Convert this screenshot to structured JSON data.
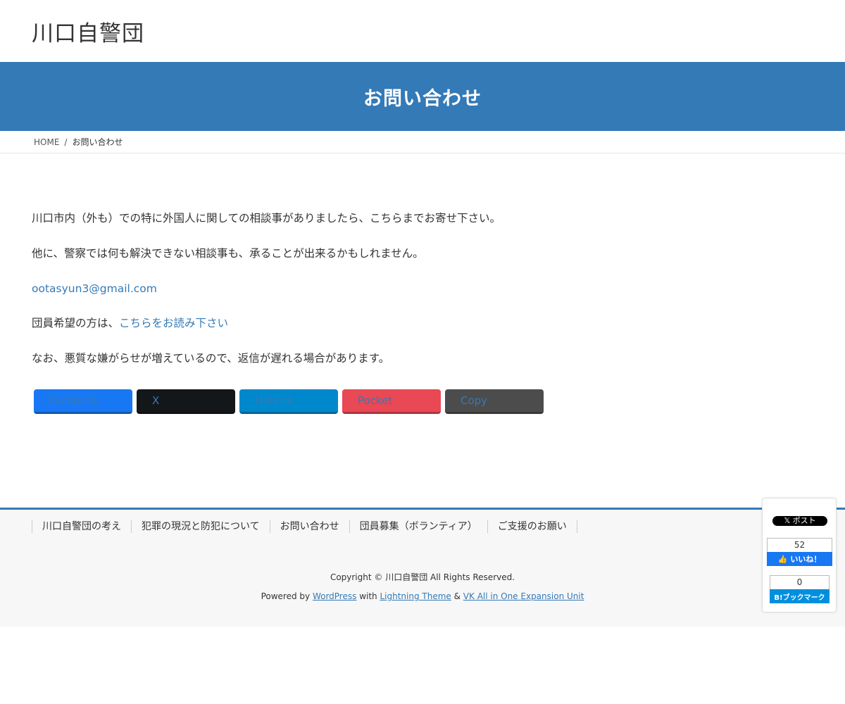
{
  "header": {
    "site_title": "川口自警団"
  },
  "page_header": {
    "title": "お問い合わせ"
  },
  "breadcrumb": {
    "home_icon": "",
    "home": "HOME",
    "separator": "/",
    "current": "お問い合わせ"
  },
  "content": {
    "p1": "川口市内（外も）での特に外国人に関しての相談事がありましたら、こちらまでお寄せ下さい。",
    "p2": "他に、警察では何も解決できない相談事も、承ることが出来るかもしれません。",
    "email": "ootasyun3@gmail.com",
    "p4_prefix": "団員希望の方は、",
    "p4_link": "こちらをお読み下さい",
    "p5": "なお、悪質な嫌がらせが増えているので、返信が遅れる場合があります。"
  },
  "share_buttons": [
    {
      "label": "Facebook",
      "icon": "",
      "color": "#1877f2"
    },
    {
      "label": "X",
      "icon": "",
      "color": "#14171a"
    },
    {
      "label": "Hatena",
      "icon": "",
      "color": "#0088cc"
    },
    {
      "label": "Pocket",
      "icon": "",
      "color": "#e94855"
    },
    {
      "label": "Copy",
      "icon": "",
      "color": "#4c4c4c"
    }
  ],
  "footer": {
    "nav": [
      "川口自警団の考え",
      "犯罪の現況と防犯について",
      "お問い合わせ",
      "団員募集（ボランティア）",
      "ご支援のお願い"
    ],
    "copyright": "Copyright © 川口自警団 All Rights Reserved.",
    "powered_prefix": "Powered by ",
    "wordpress": "WordPress",
    "with": " with ",
    "lightning": "Lightning Theme",
    "amp": " & ",
    "vk": "VK All in One Expansion Unit"
  },
  "share_widget": {
    "x_post": "𝕏 ポスト",
    "fb_count": "52",
    "fb_label": "いいね！",
    "hb_count": "0",
    "hb_label": "B!ブックマーク"
  },
  "colors": {
    "accent": "#337ab7"
  }
}
